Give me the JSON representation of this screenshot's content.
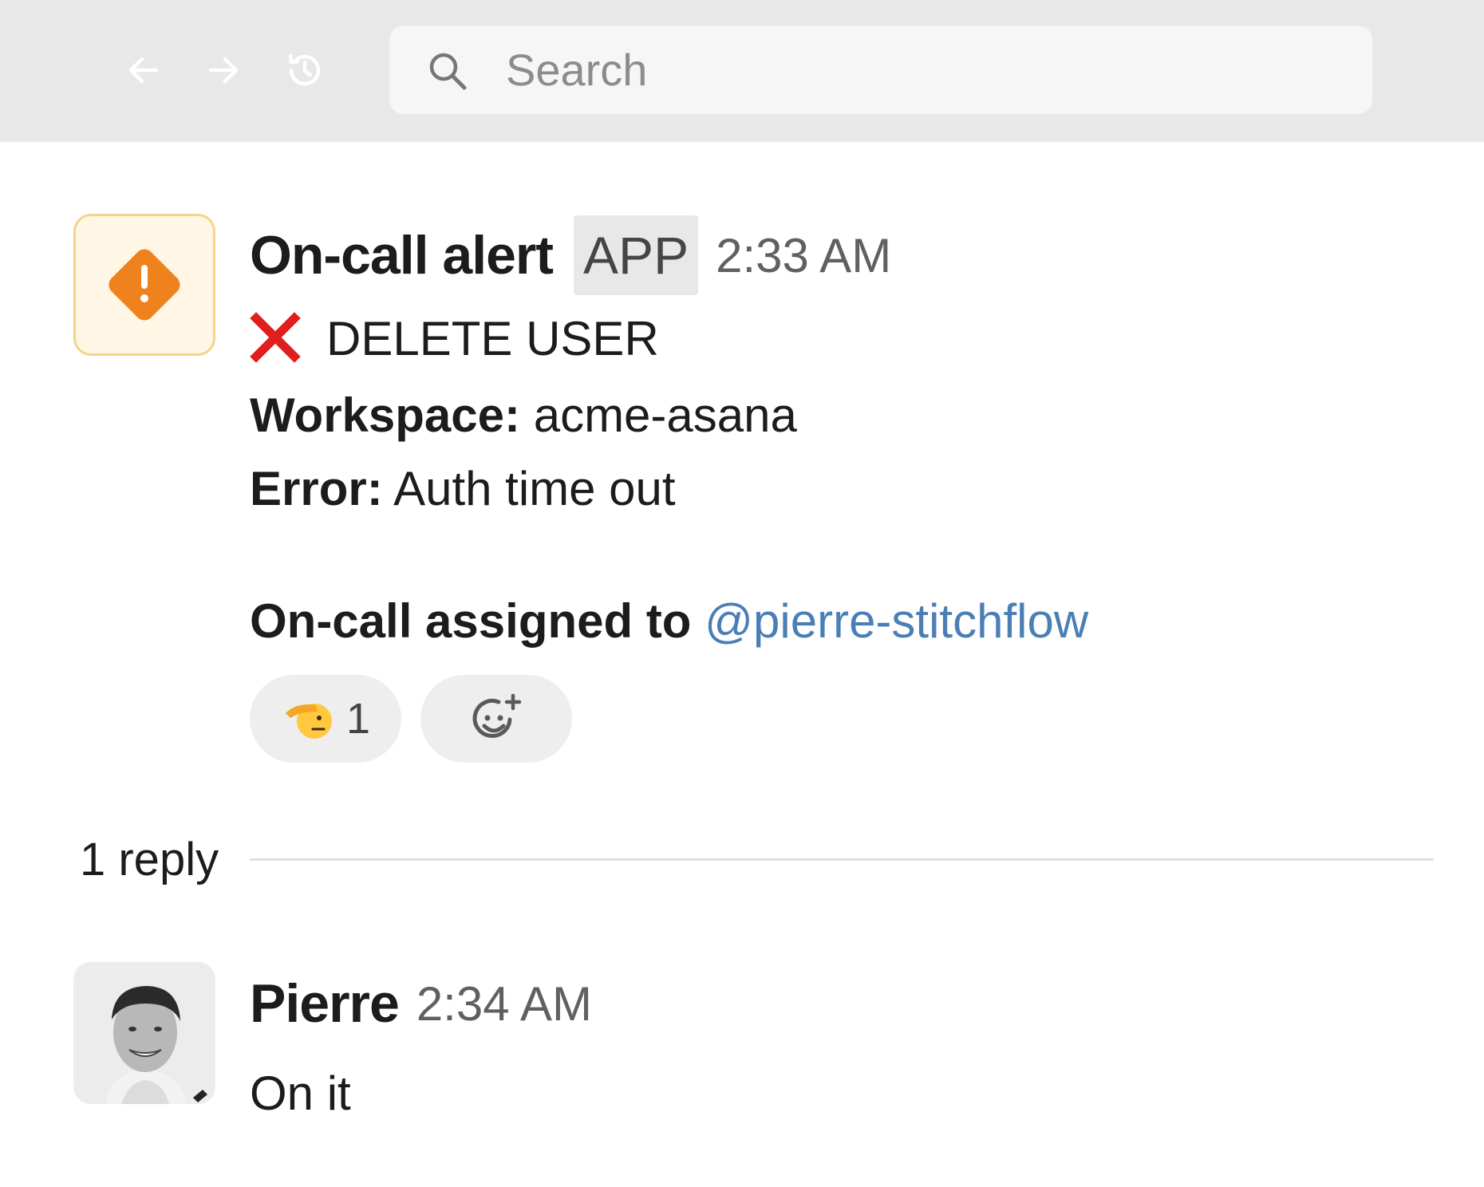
{
  "toolbar": {
    "back_icon": "arrow-left-icon",
    "forward_icon": "arrow-right-icon",
    "history_icon": "history-icon",
    "search": {
      "placeholder": "Search",
      "value": "",
      "icon": "search-icon"
    }
  },
  "alert_message": {
    "avatar_icon": "warning-diamond-icon",
    "avatar_color": "#f0821e",
    "sender": "On-call alert",
    "badge": "APP",
    "time": "2:33 AM",
    "action_icon": "red-x-icon",
    "action": "DELETE USER",
    "workspace_label": "Workspace:",
    "workspace_value": "acme-asana",
    "error_label": "Error:",
    "error_value": "Auth time out",
    "assigned_label": "On-call assigned to",
    "assigned_mention": "@pierre-stitchflow",
    "mention_color": "#4a7fb5",
    "reactions": [
      {
        "emoji_icon": "saluting-face-icon",
        "count": "1"
      }
    ],
    "add_reaction_icon": "add-emoji-icon"
  },
  "thread": {
    "reply_count_label": "1 reply"
  },
  "reply_message": {
    "sender": "Pierre",
    "time": "2:34 AM",
    "text": "On it",
    "avatar": "user-photo"
  }
}
